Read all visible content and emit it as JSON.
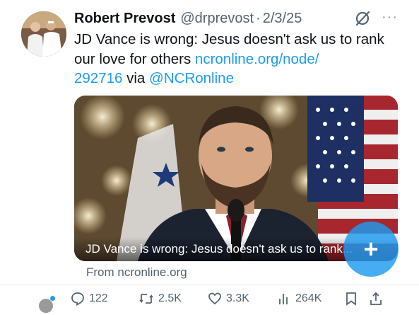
{
  "tweet": {
    "author_name": "Robert Prevost",
    "handle": "@drprevost",
    "separator": "·",
    "date": "2/3/25",
    "text_plain": "JD Vance is wrong: Jesus doesn't ask us to rank our love for others ",
    "link_part1": "ncronline.org/node/",
    "link_part2": "292716",
    "via_text": " via ",
    "mention": "@NCRonline"
  },
  "header_icons": [
    "grok-icon",
    "more-icon"
  ],
  "more_glyph": "···",
  "card": {
    "caption": "JD Vance is wrong: Jesus doesn't ask us to rank...",
    "source": "From ncronline.org"
  },
  "actions": {
    "replies": "122",
    "reposts": "2.5K",
    "likes": "3.3K",
    "views": "264K"
  },
  "fab": {
    "label": "+"
  },
  "colors": {
    "accent": "#1d9bf0",
    "text": "#0f1419",
    "secondary": "#536471"
  }
}
